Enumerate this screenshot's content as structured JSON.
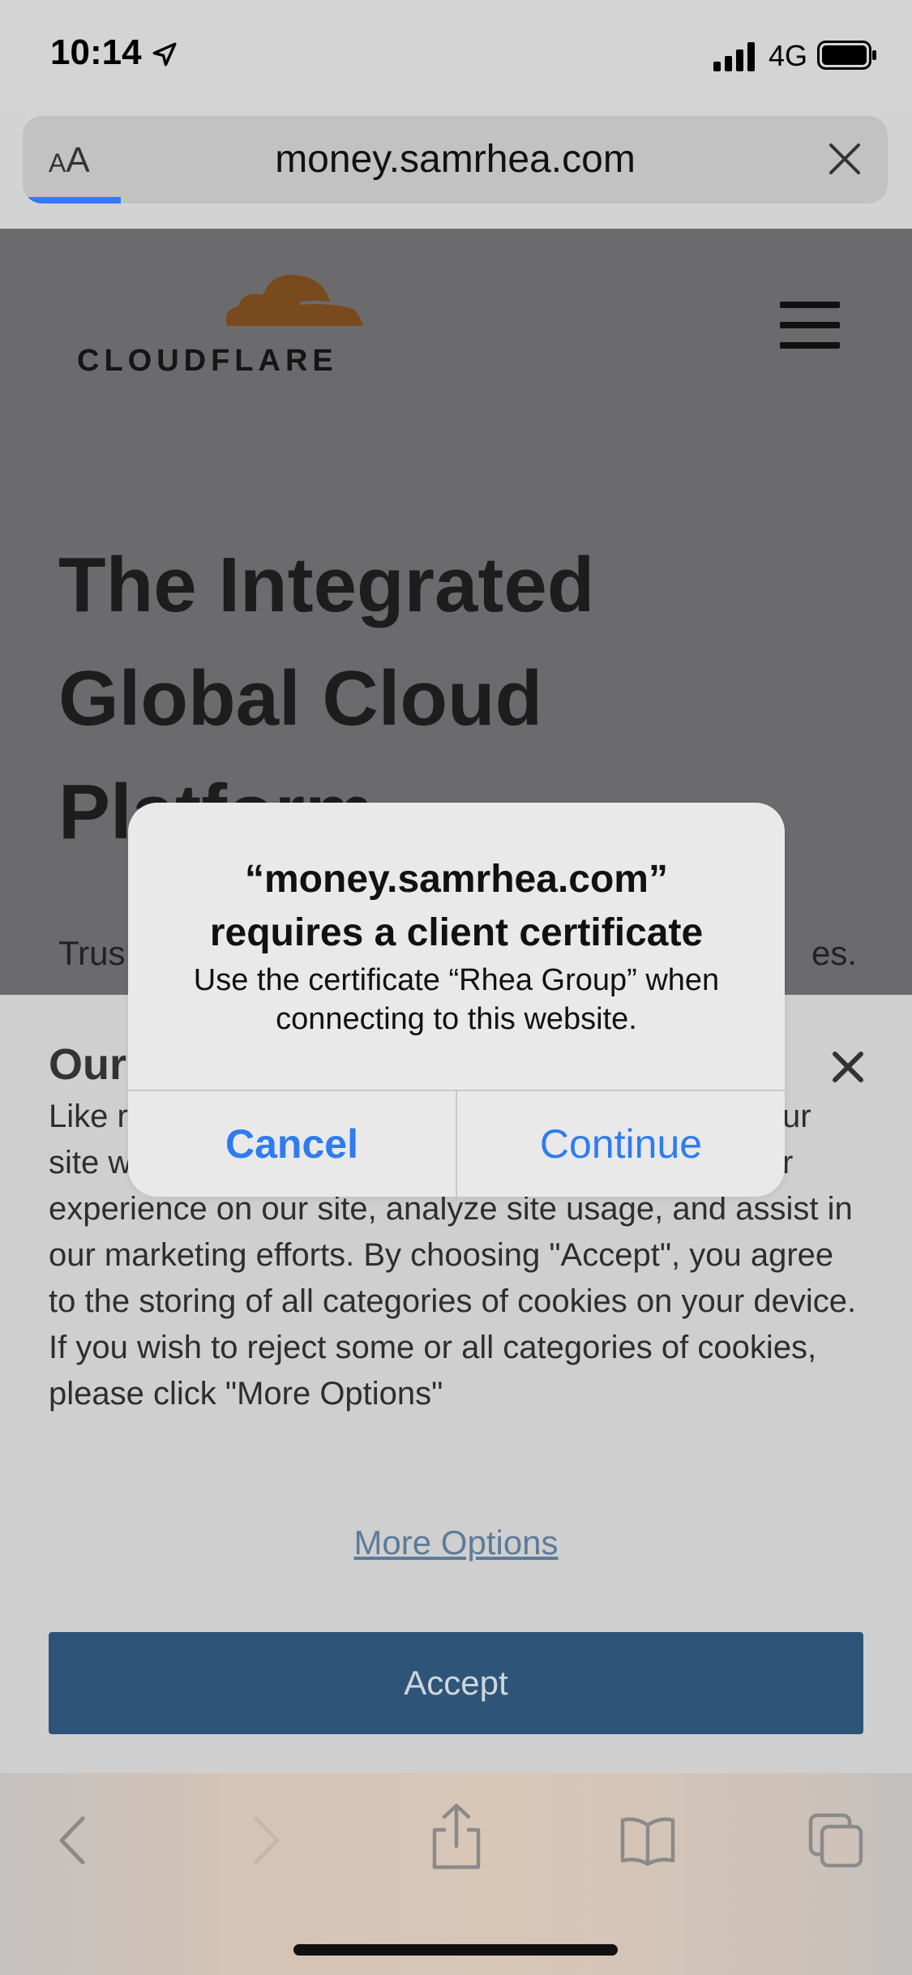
{
  "status_bar": {
    "time": "10:14",
    "network": "4G"
  },
  "url_bar": {
    "text_size_label": "AA",
    "url": "money.samrhea.com",
    "load_progress": 0.11
  },
  "page": {
    "logo_text": "CLOUDFLARE",
    "hero_lines": [
      "The Integrated",
      "Global Cloud",
      "Platform"
    ],
    "hero_visible_fragment": "Plt",
    "trust_left": "Trus",
    "trust_right": "es."
  },
  "cookie_banner": {
    "title": "Our",
    "body_line1_left": "Like r",
    "body_line1_right": "ur",
    "body_line2_left": "site w",
    "body_line2_right": "r",
    "body_rest": "experience on our site, analyze site usage, and assist in our marketing efforts. By choosing \"Accept\", you agree to the storing of all categories of cookies on your device. If you wish to reject some or all categories of cookies, please click \"More Options\"",
    "more_options_label": "More Options",
    "accept_label": "Accept"
  },
  "alert": {
    "title_line1": "“money.samrhea.com”",
    "title_line2": "requires a client certificate",
    "message": "Use the certificate “Rhea Group” when connecting to this website.",
    "cancel_label": "Cancel",
    "continue_label": "Continue"
  },
  "toolbar": {
    "icons": [
      "back-icon",
      "forward-icon",
      "share-icon",
      "bookmarks-icon",
      "tabs-icon"
    ]
  },
  "colors": {
    "accent": "#2f7bf0",
    "accept_button": "#2e5579",
    "cloudflare_orange": "#7a4a1f"
  }
}
